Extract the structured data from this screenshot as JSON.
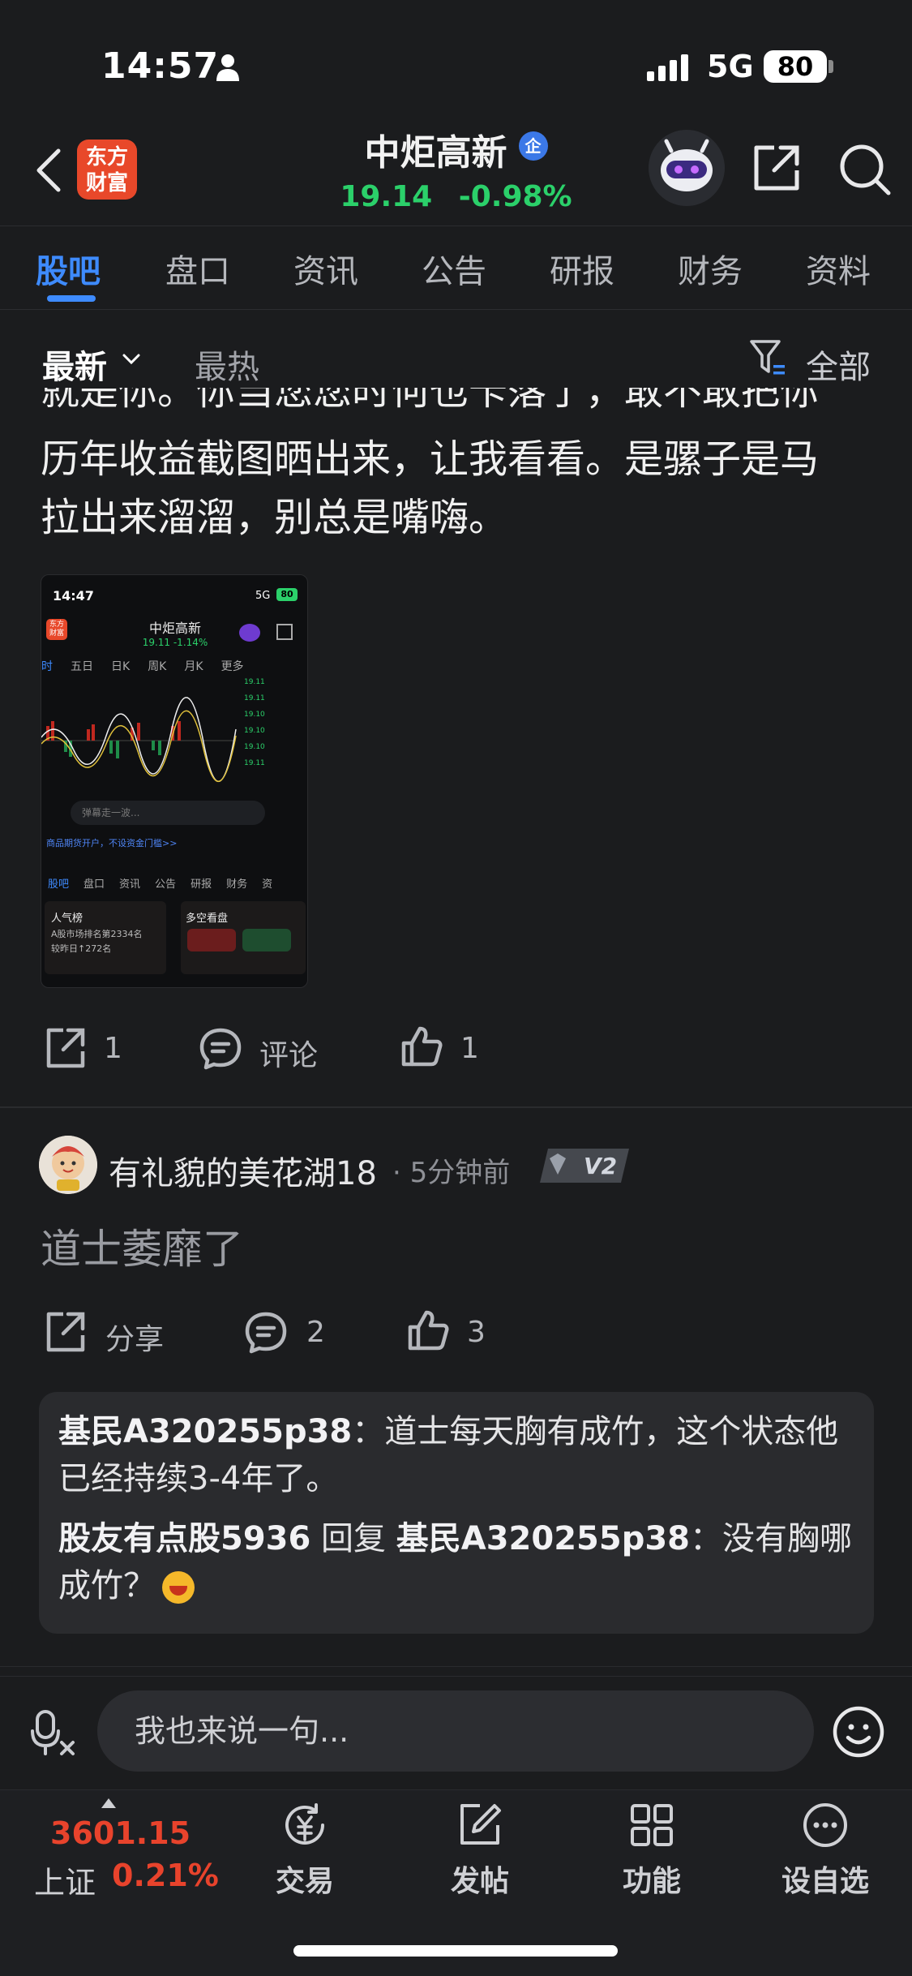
{
  "status_bar": {
    "time": "14:57",
    "network": "5G",
    "battery": "80"
  },
  "header": {
    "logo_text": "东方财富",
    "stock_name": "中炬高新",
    "verified_badge": "企",
    "price": "19.14",
    "change_pct": "-0.98%"
  },
  "tabs": [
    {
      "label": "股吧",
      "active": true
    },
    {
      "label": "盘口"
    },
    {
      "label": "资讯"
    },
    {
      "label": "公告"
    },
    {
      "label": "研报"
    },
    {
      "label": "财务"
    },
    {
      "label": "资料"
    }
  ],
  "sort": {
    "latest": "最新",
    "hot": "最热",
    "filter": "全部"
  },
  "post": {
    "cut_line": "就是你。你当您您时何也卡落了，敢不敢把你",
    "text_line1": "历年收益截图晒出来，让我看看。是骡子是马",
    "text_line2": "拉出来溜溜，别总是嘴嗨。",
    "image": {
      "time": "14:47",
      "network": "5G",
      "battery": "80",
      "logo": "东方财富",
      "title": "中炬高新",
      "price": "19.11  -1.14%",
      "tabs": [
        "时",
        "五日",
        "日K",
        "周K",
        "月K",
        "更多"
      ],
      "comment_placeholder": "弹幕走一波...",
      "banner": "商品期货开户，不设资金门槛>>",
      "nav": [
        "股吧",
        "盘口",
        "资讯",
        "公告",
        "研报",
        "财务",
        "资"
      ],
      "popularity_title": "人气榜",
      "popularity_rank1": "A股市场排名第2334名",
      "popularity_rank2": "较昨日↑272名",
      "bull_bear_title": "多空看盘"
    },
    "actions": {
      "share_count": "1",
      "comment_label": "评论",
      "like_count": "1"
    }
  },
  "comment": {
    "username": "有礼貌的美花湖18",
    "time": "· 5分钟前",
    "level": "V2",
    "body": "道士萎靡了",
    "actions": {
      "share_label": "分享",
      "reply_count": "2",
      "like_count": "3"
    },
    "replies": [
      {
        "user": "基民A320255p38",
        "sep": "：",
        "text_a": "道士每天胸有成竹，这个状态他",
        "text_b": "已经持续3-4年了。"
      },
      {
        "user": "股友有点股5936",
        "mid": " 回复 ",
        "target": "基民A320255p38",
        "sep": "：",
        "text_a": "没有胸哪",
        "text_b": "成竹？"
      }
    ]
  },
  "input": {
    "placeholder": "我也来说一句..."
  },
  "bottom_nav": {
    "index_value": "3601.15",
    "index_name": "上证",
    "index_change": "0.21%",
    "items": [
      {
        "label": "交易",
        "icon": "trade-icon"
      },
      {
        "label": "发帖",
        "icon": "post-icon"
      },
      {
        "label": "功能",
        "icon": "grid-icon"
      },
      {
        "label": "设自选",
        "icon": "more-icon"
      }
    ]
  },
  "colors": {
    "accent": "#3e8bff",
    "up": "#e8432c",
    "down": "#2bd06a",
    "background": "#1b1c1e"
  }
}
